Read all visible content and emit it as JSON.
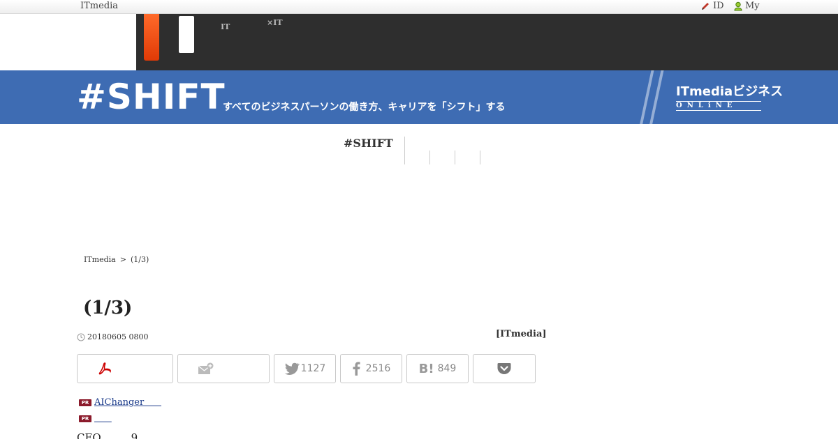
{
  "topbar": {
    "brand": "ITmedia",
    "id_link": "ID",
    "my_link": "My"
  },
  "darknav": {
    "items": [
      {
        "top": "",
        "sub": "IT"
      },
      {
        "top": "",
        "sub": "×IT"
      }
    ]
  },
  "banner": {
    "shift": "#SHIFT",
    "tagline": "すべてのビジネスパーソンの働き方、キャリアを「シフト」する",
    "logo_main": "ITmediaビジネス",
    "logo_sub": "ONLiNE"
  },
  "subnav": {
    "title": "#SHIFT"
  },
  "breadcrumb": {
    "home": "ITmedia",
    "sep": ">",
    "page": "(1/3)"
  },
  "article": {
    "title": "(1/3)",
    "date": "20180605 0800",
    "byline": "[ITmedia]",
    "body_start": "CEO         9"
  },
  "share": {
    "twitter_count": "1127",
    "facebook_count": "2516",
    "hatena_count": "849"
  },
  "pr_links": [
    {
      "badge": "PR",
      "text": "AIChanger      "
    },
    {
      "badge": "PR",
      "text": "      "
    }
  ],
  "colors": {
    "banner": "#3e6cb3",
    "darknav": "#2e2e2e",
    "accent_orange": "#e03a06",
    "pr_badge": "#8b1a2b"
  }
}
